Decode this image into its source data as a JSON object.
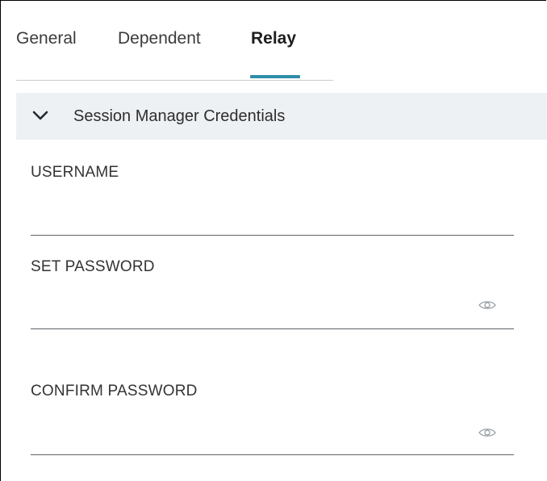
{
  "tabs": [
    {
      "label": "General",
      "active": false
    },
    {
      "label": "Dependent",
      "active": false
    },
    {
      "label": "Relay",
      "active": true
    }
  ],
  "accent_color": "#2e8ea7",
  "section": {
    "title": "Session Manager Credentials",
    "expanded": true,
    "icon": "chevron-down-icon"
  },
  "fields": {
    "username": {
      "label": "USERNAME",
      "value": ""
    },
    "set_password": {
      "label": "SET PASSWORD",
      "value": "",
      "icon": "eye-icon"
    },
    "confirm_password": {
      "label": "CONFIRM PASSWORD",
      "value": "",
      "icon": "eye-icon"
    }
  }
}
